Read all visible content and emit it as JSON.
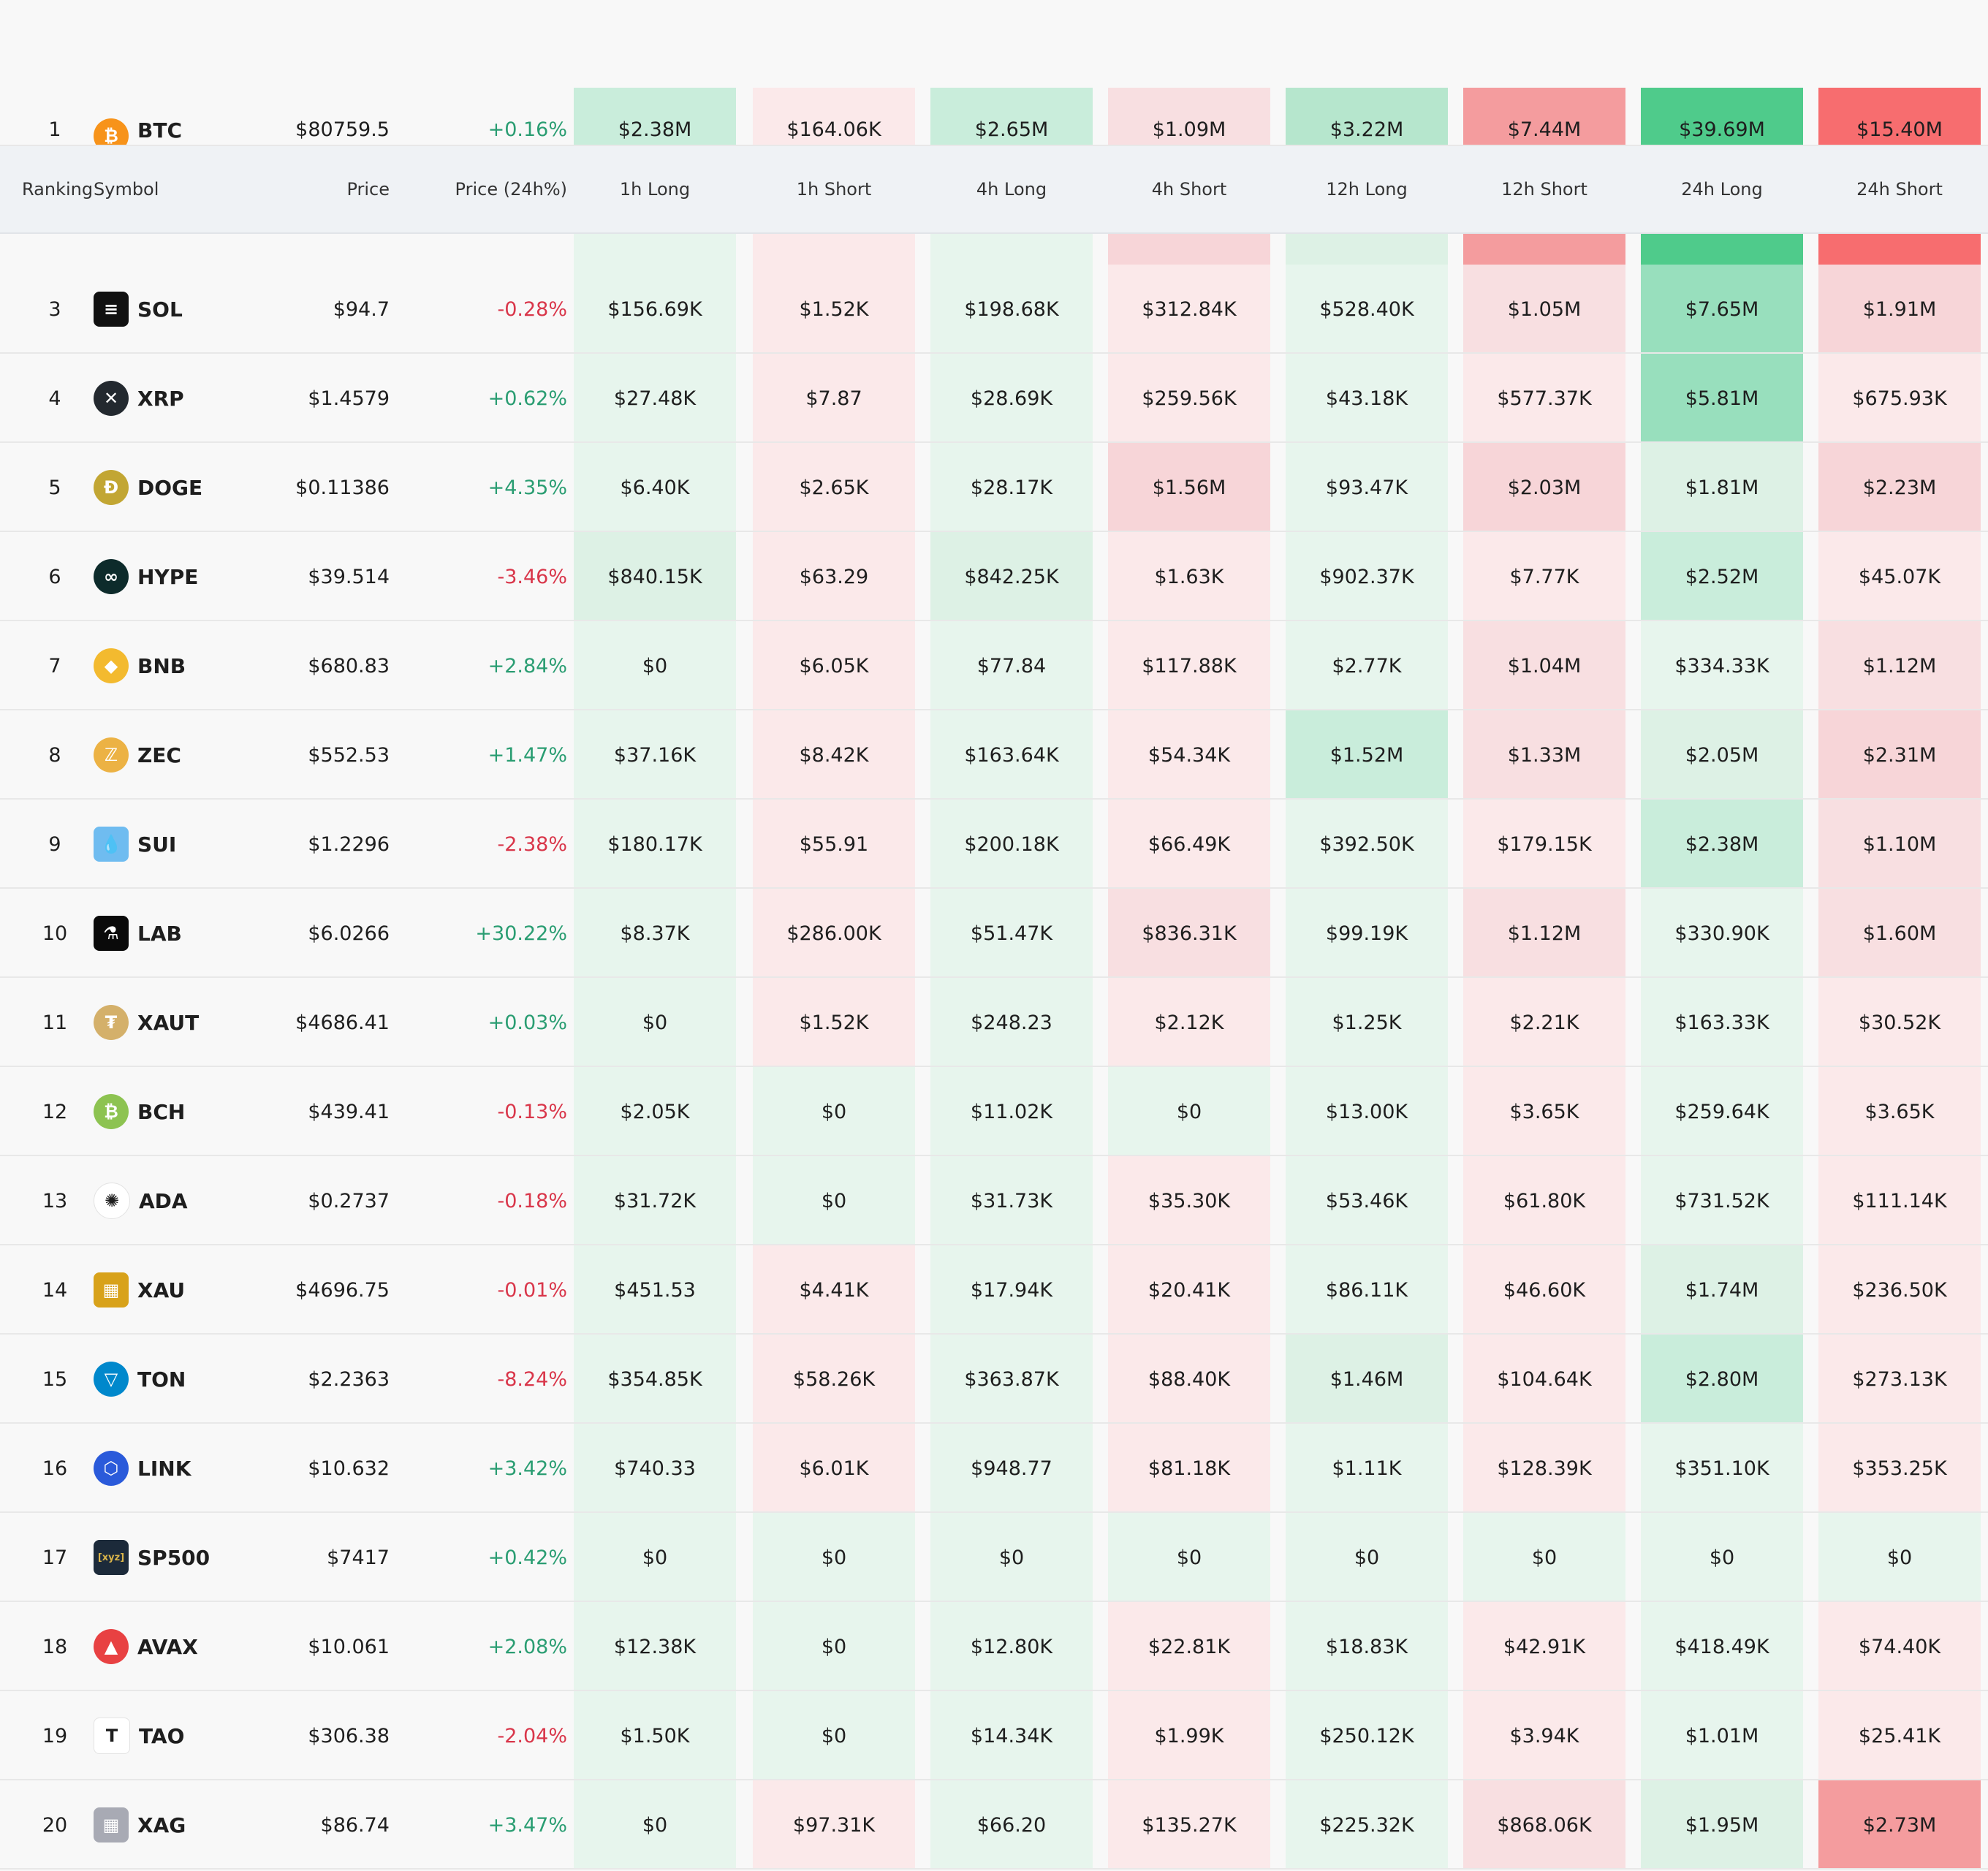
{
  "colors": {
    "long": [
      "#e7f5ed",
      "#ddf1e5",
      "#c9eddb",
      "#b6e6cd",
      "#98dfbd",
      "#4fcb8b"
    ],
    "short": [
      "#fbe9ea",
      "#f8dfe1",
      "#f7d5d8",
      "#f49c9e",
      "#f76d6f"
    ]
  },
  "table": {
    "headers": {
      "ranking": "Ranking",
      "symbol": "Symbol",
      "price": "Price",
      "change": "Price (24h%)",
      "columns": [
        "1h Long",
        "1h Short",
        "4h Long",
        "4h Short",
        "12h Long",
        "12h Short",
        "24h Long",
        "24h Short"
      ]
    },
    "rows": [
      {
        "rank": "1",
        "symbol": "BTC",
        "icon": "bitcoin-icon",
        "icon_color": "#f7931a",
        "glyph": "₿",
        "price": "$80759.5",
        "change": "+0.16%",
        "dir": "up",
        "values": [
          "$2.38M",
          "$164.06K",
          "$2.65M",
          "$1.09M",
          "$3.22M",
          "$7.44M",
          "$39.69M",
          "$15.40M"
        ],
        "levels": [
          "l2",
          "s0",
          "l2",
          "s1",
          "l3",
          "s3",
          "l5",
          "s4"
        ]
      },
      {
        "rank": "3",
        "symbol": "SOL",
        "icon": "solana-icon",
        "icon_color": "#111111",
        "glyph": "≡",
        "price": "$94.7",
        "change": "-0.28%",
        "dir": "down",
        "values": [
          "$156.69K",
          "$1.52K",
          "$198.68K",
          "$312.84K",
          "$528.40K",
          "$1.05M",
          "$7.65M",
          "$1.91M"
        ],
        "levels": [
          "l0",
          "s0",
          "l0",
          "s0",
          "l0",
          "s1",
          "l4",
          "s2"
        ]
      },
      {
        "rank": "4",
        "symbol": "XRP",
        "icon": "xrp-icon",
        "icon_color": "#23292f",
        "glyph": "✕",
        "price": "$1.4579",
        "change": "+0.62%",
        "dir": "up",
        "values": [
          "$27.48K",
          "$7.87",
          "$28.69K",
          "$259.56K",
          "$43.18K",
          "$577.37K",
          "$5.81M",
          "$675.93K"
        ],
        "levels": [
          "l0",
          "s0",
          "l0",
          "s0",
          "l0",
          "s0",
          "l4",
          "s0"
        ]
      },
      {
        "rank": "5",
        "symbol": "DOGE",
        "icon": "dogecoin-icon",
        "icon_color": "#c2a633",
        "glyph": "Ð",
        "price": "$0.11386",
        "change": "+4.35%",
        "dir": "up",
        "values": [
          "$6.40K",
          "$2.65K",
          "$28.17K",
          "$1.56M",
          "$93.47K",
          "$2.03M",
          "$1.81M",
          "$2.23M"
        ],
        "levels": [
          "l0",
          "s0",
          "l0",
          "s2",
          "l0",
          "s2",
          "l1",
          "s2"
        ]
      },
      {
        "rank": "6",
        "symbol": "HYPE",
        "icon": "hyperliquid-icon",
        "icon_color": "#0d2b2b",
        "glyph": "∞",
        "price": "$39.514",
        "change": "-3.46%",
        "dir": "down",
        "values": [
          "$840.15K",
          "$63.29",
          "$842.25K",
          "$1.63K",
          "$902.37K",
          "$7.77K",
          "$2.52M",
          "$45.07K"
        ],
        "levels": [
          "l1",
          "s0",
          "l1",
          "s0",
          "l0",
          "s0",
          "l2",
          "s0"
        ]
      },
      {
        "rank": "7",
        "symbol": "BNB",
        "icon": "bnb-icon",
        "icon_color": "#f3ba2f",
        "glyph": "◆",
        "price": "$680.83",
        "change": "+2.84%",
        "dir": "up",
        "values": [
          "$0",
          "$6.05K",
          "$77.84",
          "$117.88K",
          "$2.77K",
          "$1.04M",
          "$334.33K",
          "$1.12M"
        ],
        "levels": [
          "l0",
          "s0",
          "l0",
          "s0",
          "l0",
          "s1",
          "l0",
          "s1"
        ]
      },
      {
        "rank": "8",
        "symbol": "ZEC",
        "icon": "zcash-icon",
        "icon_color": "#ecb244",
        "glyph": "ℤ",
        "price": "$552.53",
        "change": "+1.47%",
        "dir": "up",
        "values": [
          "$37.16K",
          "$8.42K",
          "$163.64K",
          "$54.34K",
          "$1.52M",
          "$1.33M",
          "$2.05M",
          "$2.31M"
        ],
        "levels": [
          "l0",
          "s0",
          "l0",
          "s0",
          "l2",
          "s1",
          "l1",
          "s2"
        ]
      },
      {
        "rank": "9",
        "symbol": "SUI",
        "icon": "sui-icon",
        "icon_color": "#6fbcf0",
        "glyph": "💧",
        "price": "$1.2296",
        "change": "-2.38%",
        "dir": "down",
        "values": [
          "$180.17K",
          "$55.91",
          "$200.18K",
          "$66.49K",
          "$392.50K",
          "$179.15K",
          "$2.38M",
          "$1.10M"
        ],
        "levels": [
          "l0",
          "s0",
          "l0",
          "s0",
          "l0",
          "s0",
          "l2",
          "s1"
        ]
      },
      {
        "rank": "10",
        "symbol": "LAB",
        "icon": "lab-icon",
        "icon_color": "#0a0a0a",
        "glyph": "⚗",
        "price": "$6.0266",
        "change": "+30.22%",
        "dir": "up",
        "values": [
          "$8.37K",
          "$286.00K",
          "$51.47K",
          "$836.31K",
          "$99.19K",
          "$1.12M",
          "$330.90K",
          "$1.60M"
        ],
        "levels": [
          "l0",
          "s0",
          "l0",
          "s1",
          "l0",
          "s1",
          "l0",
          "s1"
        ]
      },
      {
        "rank": "11",
        "symbol": "XAUT",
        "icon": "tether-gold-icon",
        "icon_color": "#d4b06a",
        "glyph": "₮",
        "price": "$4686.41",
        "change": "+0.03%",
        "dir": "up",
        "values": [
          "$0",
          "$1.52K",
          "$248.23",
          "$2.12K",
          "$1.25K",
          "$2.21K",
          "$163.33K",
          "$30.52K"
        ],
        "levels": [
          "l0",
          "s0",
          "l0",
          "s0",
          "l0",
          "s0",
          "l0",
          "s0"
        ]
      },
      {
        "rank": "12",
        "symbol": "BCH",
        "icon": "bitcoin-cash-icon",
        "icon_color": "#8dc351",
        "glyph": "₿",
        "price": "$439.41",
        "change": "-0.13%",
        "dir": "down",
        "values": [
          "$2.05K",
          "$0",
          "$11.02K",
          "$0",
          "$13.00K",
          "$3.65K",
          "$259.64K",
          "$3.65K"
        ],
        "levels": [
          "l0",
          "l0",
          "l0",
          "l0",
          "l0",
          "s0",
          "l0",
          "s0"
        ]
      },
      {
        "rank": "13",
        "symbol": "ADA",
        "icon": "cardano-icon",
        "icon_color": "#ffffff",
        "glyph": "✺",
        "price": "$0.2737",
        "change": "-0.18%",
        "dir": "down",
        "values": [
          "$31.72K",
          "$0",
          "$31.73K",
          "$35.30K",
          "$53.46K",
          "$61.80K",
          "$731.52K",
          "$111.14K"
        ],
        "levels": [
          "l0",
          "l0",
          "l0",
          "s0",
          "l0",
          "s0",
          "l0",
          "s0"
        ]
      },
      {
        "rank": "14",
        "symbol": "XAU",
        "icon": "gold-bars-icon",
        "icon_color": "#d8a21a",
        "glyph": "▦",
        "price": "$4696.75",
        "change": "-0.01%",
        "dir": "down",
        "values": [
          "$451.53",
          "$4.41K",
          "$17.94K",
          "$20.41K",
          "$86.11K",
          "$46.60K",
          "$1.74M",
          "$236.50K"
        ],
        "levels": [
          "l0",
          "s0",
          "l0",
          "s0",
          "l0",
          "s0",
          "l1",
          "s0"
        ]
      },
      {
        "rank": "15",
        "symbol": "TON",
        "icon": "toncoin-icon",
        "icon_color": "#0088cc",
        "glyph": "▽",
        "price": "$2.2363",
        "change": "-8.24%",
        "dir": "down",
        "values": [
          "$354.85K",
          "$58.26K",
          "$363.87K",
          "$88.40K",
          "$1.46M",
          "$104.64K",
          "$2.80M",
          "$273.13K"
        ],
        "levels": [
          "l0",
          "s0",
          "l0",
          "s0",
          "l1",
          "s0",
          "l2",
          "s0"
        ]
      },
      {
        "rank": "16",
        "symbol": "LINK",
        "icon": "chainlink-icon",
        "icon_color": "#2a5ada",
        "glyph": "⬡",
        "price": "$10.632",
        "change": "+3.42%",
        "dir": "up",
        "values": [
          "$740.33",
          "$6.01K",
          "$948.77",
          "$81.18K",
          "$1.11K",
          "$128.39K",
          "$351.10K",
          "$353.25K"
        ],
        "levels": [
          "l0",
          "s0",
          "l0",
          "s0",
          "l0",
          "s0",
          "l0",
          "s0"
        ]
      },
      {
        "rank": "17",
        "symbol": "SP500",
        "icon": "sp500-icon",
        "icon_color": "#1c2a3a",
        "glyph": "[xyz]",
        "price": "$7417",
        "change": "+0.42%",
        "dir": "up",
        "values": [
          "$0",
          "$0",
          "$0",
          "$0",
          "$0",
          "$0",
          "$0",
          "$0"
        ],
        "levels": [
          "l0",
          "l0",
          "l0",
          "l0",
          "l0",
          "l0",
          "l0",
          "l0"
        ]
      },
      {
        "rank": "18",
        "symbol": "AVAX",
        "icon": "avalanche-icon",
        "icon_color": "#e84142",
        "glyph": "▲",
        "price": "$10.061",
        "change": "+2.08%",
        "dir": "up",
        "values": [
          "$12.38K",
          "$0",
          "$12.80K",
          "$22.81K",
          "$18.83K",
          "$42.91K",
          "$418.49K",
          "$74.40K"
        ],
        "levels": [
          "l0",
          "l0",
          "l0",
          "s0",
          "l0",
          "s0",
          "l0",
          "s0"
        ]
      },
      {
        "rank": "19",
        "symbol": "TAO",
        "icon": "bittensor-icon",
        "icon_color": "#ffffff",
        "glyph": "T",
        "price": "$306.38",
        "change": "-2.04%",
        "dir": "down",
        "values": [
          "$1.50K",
          "$0",
          "$14.34K",
          "$1.99K",
          "$250.12K",
          "$3.94K",
          "$1.01M",
          "$25.41K"
        ],
        "levels": [
          "l0",
          "l0",
          "l0",
          "s0",
          "l0",
          "s0",
          "l0",
          "s0"
        ]
      },
      {
        "rank": "20",
        "symbol": "XAG",
        "icon": "silver-bars-icon",
        "icon_color": "#a8aab4",
        "glyph": "▦",
        "price": "$86.74",
        "change": "+3.47%",
        "dir": "up",
        "values": [
          "$0",
          "$97.31K",
          "$66.20",
          "$135.27K",
          "$225.32K",
          "$868.06K",
          "$1.95M",
          "$2.73M"
        ],
        "levels": [
          "l0",
          "s0",
          "l0",
          "s0",
          "l0",
          "s1",
          "l1",
          "s3"
        ]
      }
    ],
    "strip_levels": [
      "l0",
      "s0",
      "l0",
      "s2",
      "l1",
      "s3",
      "l5",
      "s4"
    ]
  }
}
